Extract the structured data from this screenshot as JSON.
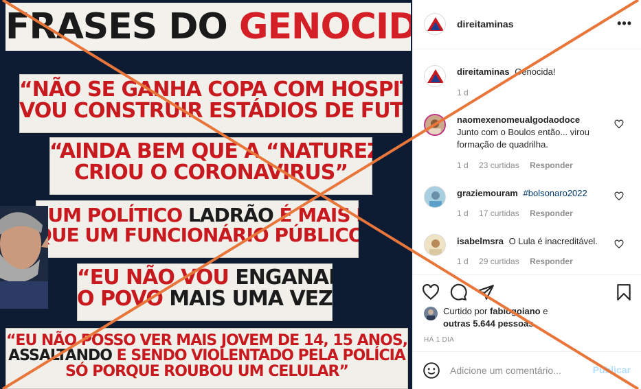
{
  "image": {
    "title_part1": "FRASES DO",
    "title_part2": "GENOCIDA:",
    "quotes": [
      {
        "lines": [
          "“NÃO SE GANHA COPA COM HOSPITAIS,",
          "VOU CONSTRUIR ESTÁDIOS DE FUTEBOL”"
        ]
      },
      {
        "lines": [
          "“AINDA BEM QUE A “NATUREZA”",
          "CRIOU O CORONAVIRUS”"
        ]
      },
      {
        "lines": [
          "“UM POLÍTICO",
          "LADRÃO",
          "É MAIS DIGNO",
          "QUE UM FUNCIONÁRIO PÚBLICO”"
        ]
      },
      {
        "lines": [
          "“EU NÃO VOU",
          "ENGANAR",
          "O POVO",
          "MAIS UMA VEZ”"
        ]
      },
      {
        "lines": [
          "“EU NÃO POSSO VER MAIS JOVEM DE 14, 15 ANOS,",
          "ASSALTANDO",
          "E SENDO VIOLENTADO PELA POLÍCIA",
          "SÓ PORQUE ROUBOU UM CELULAR”"
        ]
      }
    ]
  },
  "header": {
    "username": "direitaminas",
    "more_icon": "•••"
  },
  "caption": {
    "username": "direitaminas",
    "text": "Genocida!",
    "time": "1 d"
  },
  "comments": [
    {
      "username": "naomexenomeualgodaodoce",
      "text": "Junto com o Boulos então... virou formação de quadrilha.",
      "time": "1 d",
      "likes": "23 curtidas",
      "reply": "Responder"
    },
    {
      "username": "graziemouram",
      "text": "#bolsonaro2022",
      "time": "1 d",
      "likes": "17 curtidas",
      "reply": "Responder"
    },
    {
      "username": "isabelmsra",
      "text": "O Lula é inacreditável.",
      "time": "1 d",
      "likes": "29 curtidas",
      "reply": "Responder"
    }
  ],
  "likes": {
    "prefix": "Curtido por",
    "user": "fabiogoiano",
    "connector": "e",
    "others": "outras 5.644 pessoas"
  },
  "time_ago": "HÁ 1 DIA",
  "add_comment": {
    "placeholder": "Adicione um comentário...",
    "publish_label": "Publicar"
  },
  "colors": {
    "overlay_x": "#e8763a",
    "quote_red": "#c8191f",
    "link_blue": "#00376b",
    "publish_disabled": "#b2dffc"
  },
  "icons": [
    "more-icon",
    "heart-icon",
    "comment-icon",
    "share-icon",
    "bookmark-icon",
    "emoji-icon"
  ]
}
